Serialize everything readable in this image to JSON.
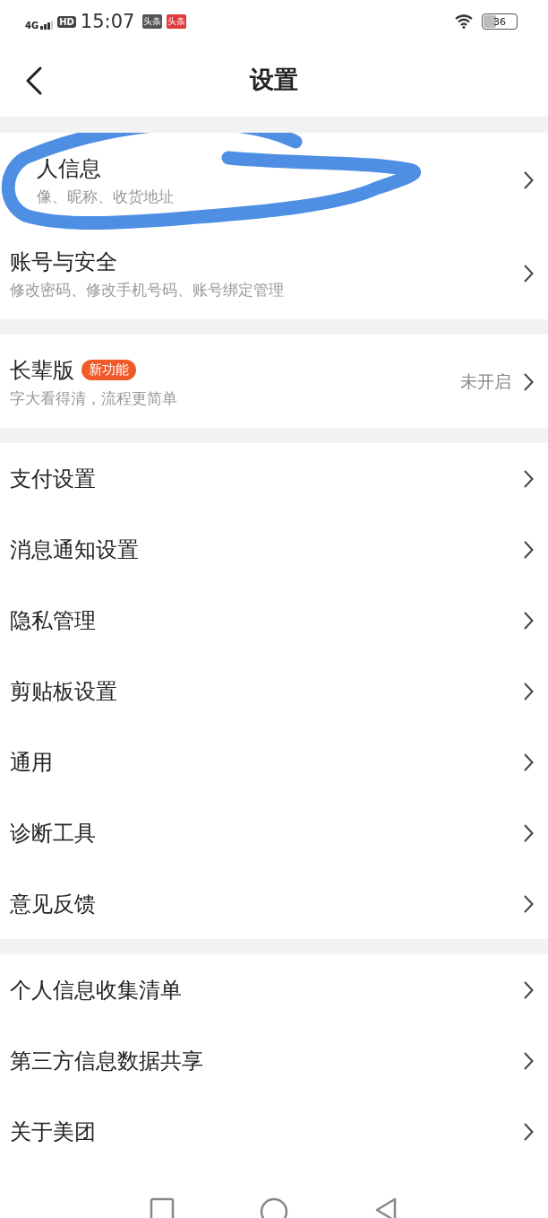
{
  "status_bar": {
    "network": "4G",
    "hd": "HD",
    "time": "15:07",
    "notifications": [
      {
        "label": "头条",
        "kind": "dark"
      },
      {
        "label": "头条",
        "kind": "red"
      }
    ],
    "battery": "36"
  },
  "header": {
    "title": "设置"
  },
  "annotation": {
    "kind": "scribble"
  },
  "groups": [
    {
      "items": [
        {
          "title": "人信息",
          "subtitle": "像、昵称、收货地址"
        },
        {
          "title": "账号与安全",
          "subtitle": "修改密码、修改手机号码、账号绑定管理"
        }
      ]
    },
    {
      "items": [
        {
          "title": "长辈版",
          "badge": "新功能",
          "subtitle": "字大看得清，流程更简单",
          "value": "未开启"
        }
      ]
    },
    {
      "items": [
        {
          "title": "支付设置"
        },
        {
          "title": "消息通知设置"
        },
        {
          "title": "隐私管理"
        },
        {
          "title": "剪贴板设置"
        },
        {
          "title": "通用"
        },
        {
          "title": "诊断工具"
        },
        {
          "title": "意见反馈"
        }
      ]
    },
    {
      "items": [
        {
          "title": "个人信息收集清单"
        },
        {
          "title": "第三方信息数据共享"
        },
        {
          "title": "关于美团"
        }
      ]
    }
  ]
}
